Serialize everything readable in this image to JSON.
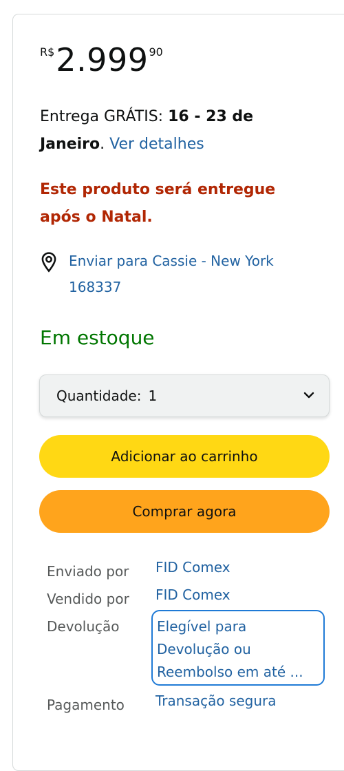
{
  "price": {
    "currency_symbol": "R$",
    "whole": "2.999",
    "fraction": "90"
  },
  "delivery": {
    "prefix": "Entrega GRÁTIS: ",
    "dates": "16 - 23 de Janeiro",
    "suffix": ". ",
    "details_link": "Ver detalhes"
  },
  "warning": "Este produto será entregue após o Natal.",
  "location": {
    "icon": "location-pin-icon",
    "text": "Enviar para Cassie - New York 168337"
  },
  "stock_status": "Em estoque",
  "quantity": {
    "label": "Quantidade:",
    "value": "1",
    "icon": "chevron-down-icon"
  },
  "buttons": {
    "add_to_cart": "Adicionar ao carrinho",
    "buy_now": "Comprar agora"
  },
  "seller_info": {
    "shipped_by_label": "Enviado por",
    "shipped_by_value": "FID Comex",
    "sold_by_label": "Vendido por",
    "sold_by_value": "FID Comex",
    "returns_label": "Devolução",
    "returns_value": "Elegível para Devolução ou Reembolso em até ...",
    "payment_label": "Pagamento",
    "payment_value": "Transação segura"
  },
  "colors": {
    "price_text": "#0f1111",
    "link": "#2162a1",
    "warning": "#b12704",
    "in_stock": "#007600",
    "add_to_cart_bg": "#ffd814",
    "buy_now_bg": "#ffa41c",
    "focus_border": "#1f7ad6"
  }
}
